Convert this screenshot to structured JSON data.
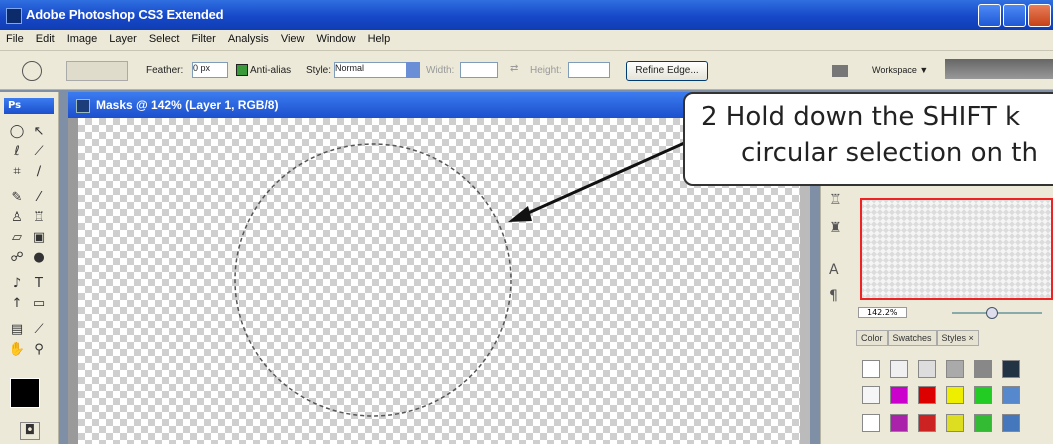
{
  "window": {
    "title": "Adobe Photoshop CS3 Extended"
  },
  "menu": [
    "File",
    "Edit",
    "Image",
    "Layer",
    "Select",
    "Filter",
    "Analysis",
    "View",
    "Window",
    "Help"
  ],
  "options": {
    "feather_label": "Feather:",
    "feather_value": "0 px",
    "antialias_label": "Anti-alias",
    "style_label": "Style:",
    "style_value": "Normal",
    "width_label": "Width:",
    "height_label": "Height:",
    "refine_edge": "Refine Edge...",
    "workspace": "Workspace ▼"
  },
  "toolbox": {
    "label": "Ps"
  },
  "document": {
    "title": "Masks @ 142% (Layer 1, RGB/8)"
  },
  "navigator": {
    "zoom": "142.2%"
  },
  "panels": {
    "tabs": [
      "Color",
      "Swatches",
      "Styles ×"
    ]
  },
  "callout": {
    "line1": "2  Hold down the SHIFT k",
    "line2": "circular selection on th"
  },
  "colors": {
    "accent": "#1c4fcc",
    "callout_border": "#333333",
    "nav_frame": "#e22222"
  }
}
